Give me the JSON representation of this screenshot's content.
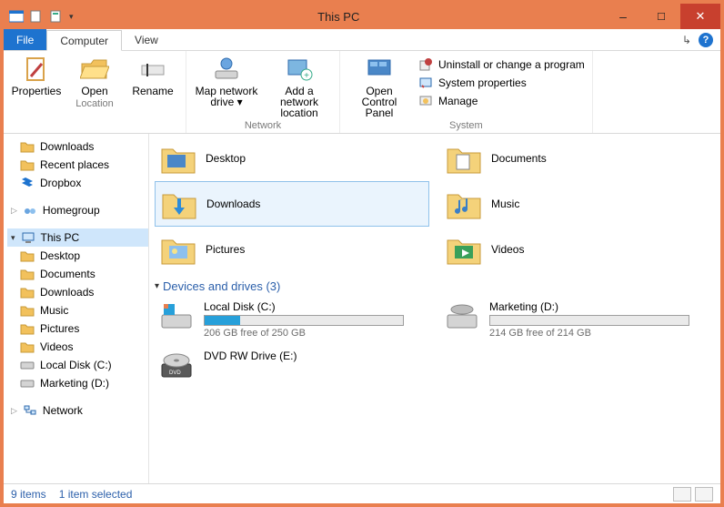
{
  "window": {
    "title": "This PC"
  },
  "tabs": {
    "file": "File",
    "computer": "Computer",
    "view": "View"
  },
  "ribbon": {
    "location": {
      "title": "Location",
      "properties": "Properties",
      "open": "Open",
      "rename": "Rename"
    },
    "network": {
      "title": "Network",
      "map": "Map network drive ▾",
      "add": "Add a network location"
    },
    "system": {
      "title": "System",
      "control": "Open Control Panel",
      "uninstall": "Uninstall or change a program",
      "sysprops": "System properties",
      "manage": "Manage"
    }
  },
  "nav": {
    "downloads": "Downloads",
    "recent": "Recent places",
    "dropbox": "Dropbox",
    "homegroup": "Homegroup",
    "thispc": "This PC",
    "desktop": "Desktop",
    "documents": "Documents",
    "downloads2": "Downloads",
    "music": "Music",
    "pictures": "Pictures",
    "videos": "Videos",
    "localdisk": "Local Disk (C:)",
    "marketing": "Marketing (D:)",
    "network": "Network"
  },
  "folders": {
    "desktop": "Desktop",
    "documents": "Documents",
    "downloads": "Downloads",
    "music": "Music",
    "pictures": "Pictures",
    "videos": "Videos"
  },
  "section": {
    "devices": "Devices and drives (3)"
  },
  "drives": {
    "c": {
      "name": "Local Disk (C:)",
      "free": "206 GB free of 250 GB",
      "fillpct": 18
    },
    "d": {
      "name": "Marketing (D:)",
      "free": "214 GB free of 214 GB",
      "fillpct": 0
    },
    "e": {
      "name": "DVD RW Drive (E:)"
    }
  },
  "status": {
    "items": "9 items",
    "selected": "1 item selected"
  }
}
